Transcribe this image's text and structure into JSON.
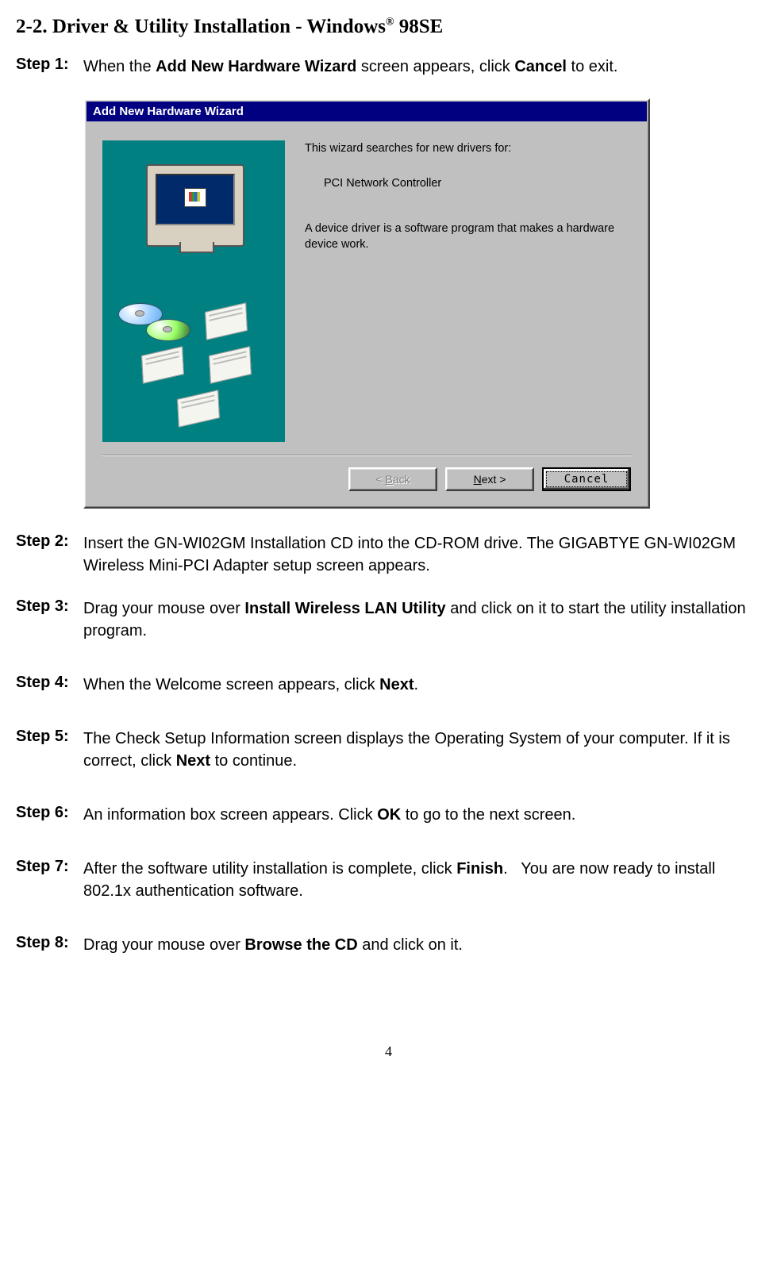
{
  "heading": {
    "prefix": "2-2.    Driver & Utility Installation - Windows",
    "reg": "®",
    "suffix": " 98SE"
  },
  "steps": [
    {
      "label": "Step 1:",
      "html": "When the <b>Add New Hardware Wizard</b> screen appears, click <b>Cancel</b> to exit."
    },
    {
      "label": "Step 2:",
      "html": "Insert the GN-WI02GM Installation CD into the CD-ROM drive. The GIGABTYE GN-WI02GM Wireless Mini-PCI Adapter setup screen appears."
    },
    {
      "label": "Step 3:",
      "html": "Drag your mouse over <b>Install Wireless LAN Utility</b> and click on it to start the utility installation program."
    },
    {
      "label": "Step 4:",
      "html": "When the Welcome screen appears, click <b>Next</b>."
    },
    {
      "label": "Step 5:",
      "html": "The Check Setup Information screen displays the Operating System of your computer. If it is correct, click <b>Next</b> to continue."
    },
    {
      "label": "Step 6:",
      "html": "An information box screen appears. Click <b>OK</b> to go to the next screen."
    },
    {
      "label": "Step 7:",
      "html": "After the software utility installation is complete, click <b>Finish</b>.&nbsp;&nbsp;&nbsp;You are now ready to install 802.1x authentication software."
    },
    {
      "label": "Step 8:",
      "html": "Drag your mouse over <b>Browse the CD</b> and click on it."
    }
  ],
  "dialog": {
    "title": "Add New Hardware Wizard",
    "line1": "This wizard searches for new drivers for:",
    "device": "PCI Network Controller",
    "line3": "A device driver is a software program that makes a hardware device work.",
    "buttons": {
      "back": "< Back",
      "next": "Next >",
      "cancel": "Cancel"
    }
  },
  "page_number": "4"
}
